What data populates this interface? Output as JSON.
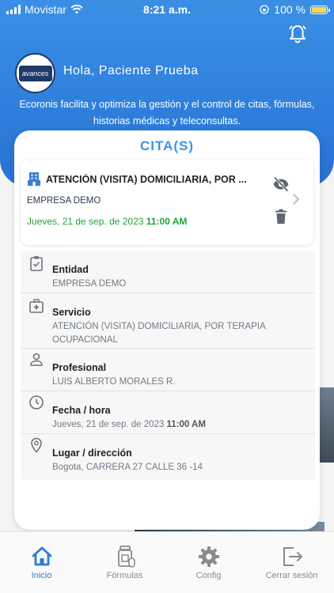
{
  "status_bar": {
    "carrier": "Movistar",
    "time": "8:21 a.m.",
    "battery": "100 %"
  },
  "header": {
    "logo_text": "avances",
    "greeting": "Hola, Paciente Prueba",
    "intro": "Ecoronis facilita y optimiza la gestión y el control de citas, fórmulas, historias médicas y teleconsultas."
  },
  "card": {
    "title": "CITA(S)",
    "appointment": {
      "title": "ATENCIÓN (VISITA) DOMICILIARIA, POR ...",
      "company": "EMPRESA DEMO",
      "date": "Jueves, 21 de sep. de 2023 ",
      "time": "11:00 AM"
    },
    "details": [
      {
        "label": "Entidad",
        "value": "EMPRESA DEMO"
      },
      {
        "label": "Servicio",
        "value": "ATENCIÓN (VISITA) DOMICILIARIA, POR TERAPIA OCUPACIONAL"
      },
      {
        "label": "Profesional",
        "value": "LUIS ALBERTO MORALES R."
      },
      {
        "label": "Fecha / hora",
        "value": "Jueves, 21 de sep. de 2023 ",
        "value_bold": "11:00 AM"
      },
      {
        "label": "Lugar / dirección",
        "value": "Bogota, CARRERA 27 CALLE 36 -14"
      }
    ]
  },
  "nav": {
    "items": [
      {
        "label": "Inicio",
        "icon": "home-icon",
        "active": true
      },
      {
        "label": "Fórmulas",
        "icon": "medicine-icon",
        "active": false
      },
      {
        "label": "Config",
        "icon": "gear-icon",
        "active": false
      },
      {
        "label": "Cerrar sesión",
        "icon": "logout-icon",
        "active": false
      }
    ]
  },
  "colors": {
    "header_blue": "#2f80dc",
    "accent_blue": "#3a93e6",
    "date_green": "#1fa53a",
    "nav_active": "#2d7ad6"
  }
}
